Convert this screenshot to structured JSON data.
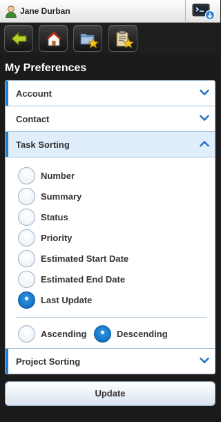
{
  "user": {
    "name": "Jane Durban"
  },
  "toolbar": {
    "buttons": [
      {
        "icon": "back-arrow-icon"
      },
      {
        "icon": "home-icon"
      },
      {
        "icon": "folder-favorite-icon"
      },
      {
        "icon": "clipboard-favorite-icon"
      }
    ],
    "console_icon": "console-icon"
  },
  "page": {
    "title": "My Preferences"
  },
  "sections": {
    "account": "Account",
    "contact": "Contact",
    "task_sorting": "Task Sorting",
    "project_sorting": "Project Sorting"
  },
  "task_sorting": {
    "fields": [
      "Number",
      "Summary",
      "Status",
      "Priority",
      "Estimated Start Date",
      "Estimated End Date",
      "Last Update"
    ],
    "selected_field": "Last Update",
    "order": [
      "Ascending",
      "Descending"
    ],
    "selected_order": "Descending"
  },
  "actions": {
    "update": "Update"
  },
  "colors": {
    "accent": "#1f7fcf",
    "radio_checked": "#0c63b4",
    "header_open_bg": "#e0eefb"
  }
}
